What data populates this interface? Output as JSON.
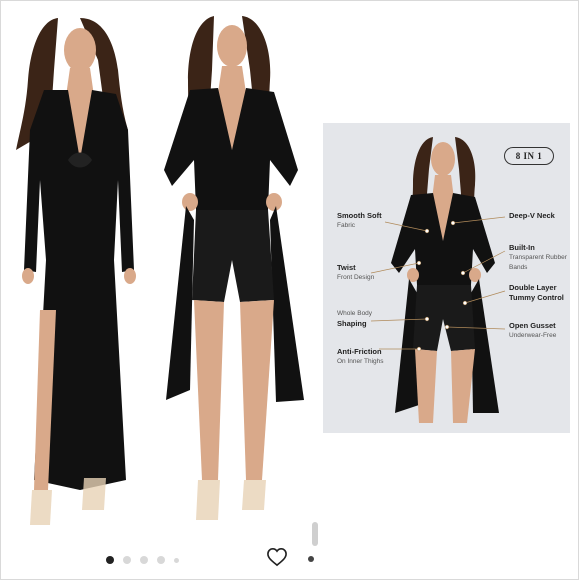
{
  "colors": {
    "dress": "#111111",
    "skin": "#d9a98a",
    "hair": "#3b2417",
    "panel_bg": "#e4e6ea",
    "accent_line": "#b08a5a"
  },
  "gallery": {
    "dots_count": 5,
    "active_dot": 1,
    "favorite_icon": "heart-outline-icon"
  },
  "infographic": {
    "badge": "8 IN 1",
    "features_left": [
      {
        "title": "Smooth Soft",
        "sub": "Fabric"
      },
      {
        "title": "Twist",
        "sub": "Front Design"
      },
      {
        "title": "Shaping",
        "pre": "Whole Body"
      },
      {
        "title": "Anti-Friction",
        "sub": "On Inner Thighs"
      }
    ],
    "features_right": [
      {
        "title": "Deep-V Neck",
        "sub": ""
      },
      {
        "title": "Built-In",
        "sub": "Transparent Rubber Bands"
      },
      {
        "title": "Double Layer Tummy Control",
        "sub": ""
      },
      {
        "title": "Open Gusset",
        "sub": "Underwear-Free"
      }
    ]
  }
}
